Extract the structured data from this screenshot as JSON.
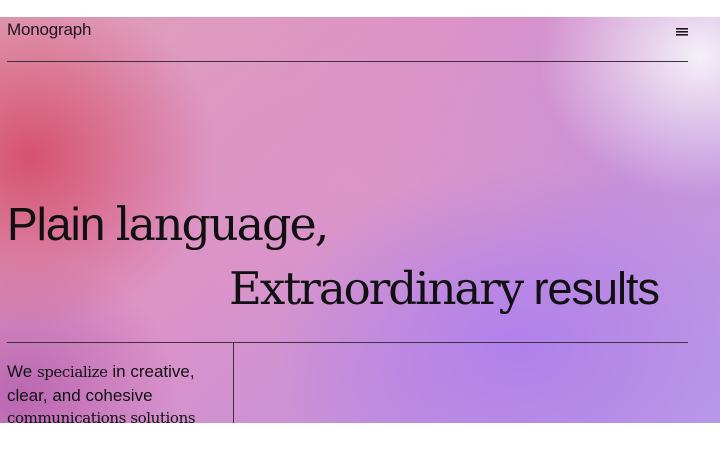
{
  "brand": {
    "name": "Monograph"
  },
  "menu": {
    "icon": "menu-icon"
  },
  "hero": {
    "headline": {
      "line1_part1": "Plain",
      "line1_part2": "language,",
      "line2_part1": "Extraordinary",
      "line2_part2": "results"
    },
    "subtext": {
      "line1_part1": "We",
      "line1_part2": "specialize",
      "line1_part3": "in creative,",
      "line2": "clear, and cohesive",
      "line3": "communications solutions"
    }
  },
  "colors": {
    "text": "#111013",
    "rule": "#3f2f42",
    "gradient_pink": "#d64e6c",
    "gradient_violet": "#af80ec"
  }
}
